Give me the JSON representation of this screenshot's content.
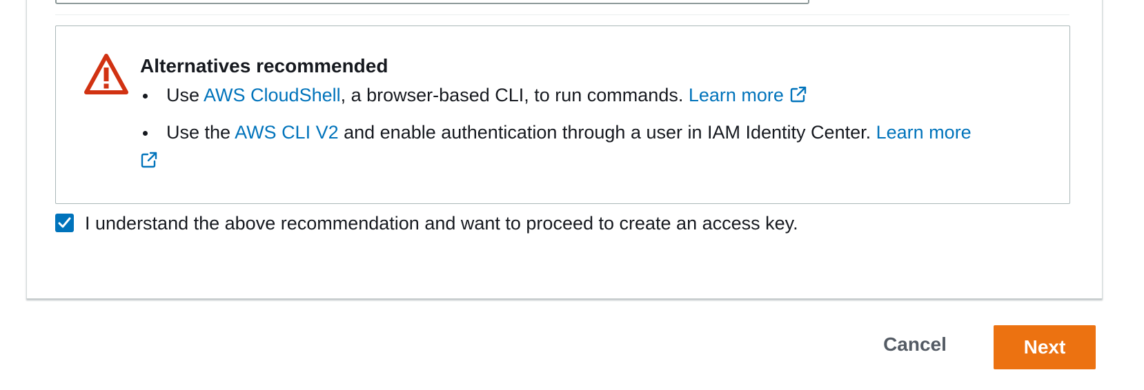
{
  "alert": {
    "icon": "warning-triangle-icon",
    "title": "Alternatives recommended",
    "items": [
      {
        "prefix": "Use ",
        "link": "AWS CloudShell",
        "middle": ", a browser-based CLI, to run commands. ",
        "learn_more": "Learn more",
        "learn_more_icon": "external-link-icon"
      },
      {
        "prefix": "Use the ",
        "link": "AWS CLI V2",
        "middle": " and enable authentication through a user in IAM Identity Center. ",
        "learn_more": "Learn more",
        "learn_more_icon": "external-link-icon"
      }
    ]
  },
  "confirmation": {
    "checked": true,
    "label": "I understand the above recommendation and want to proceed to create an access key."
  },
  "footer": {
    "cancel_label": "Cancel",
    "next_label": "Next"
  },
  "colors": {
    "link": "#0073bb",
    "warning": "#d13212",
    "checkbox": "#0073bb",
    "primary_button": "#ec7211",
    "secondary_text": "#545b64"
  }
}
